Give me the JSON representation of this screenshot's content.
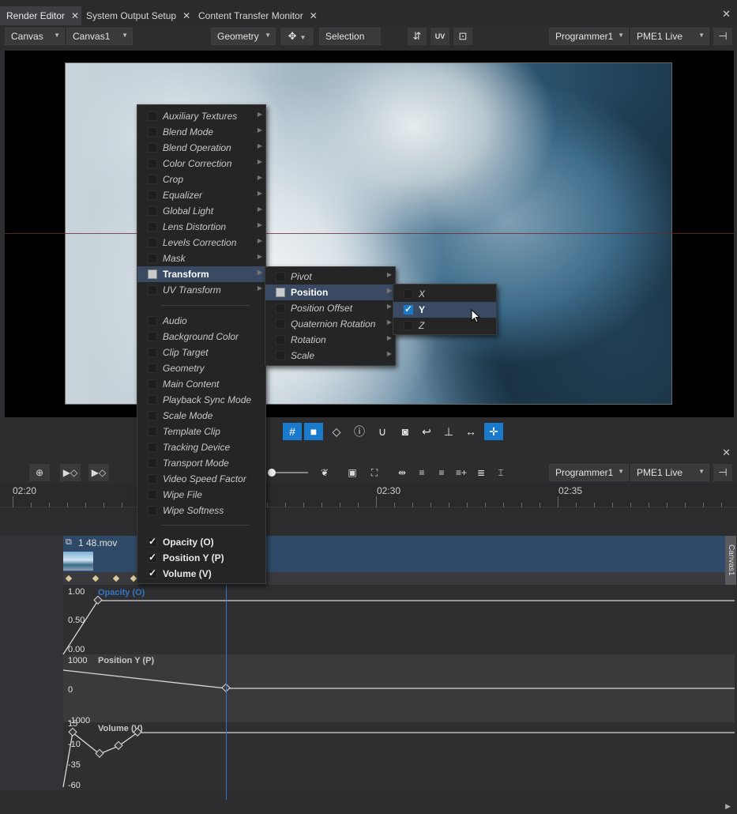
{
  "tabs": [
    {
      "label": "Render Editor",
      "active": true
    },
    {
      "label": "System Output Setup",
      "active": false
    },
    {
      "label": "Content Transfer Monitor",
      "active": false
    }
  ],
  "toolbar": {
    "canvas_type": "Canvas",
    "canvas_name": "Canvas1",
    "mode": "Geometry",
    "selection": "Selection",
    "programmer": "Programmer1",
    "live": "PME1 Live",
    "icons": [
      "move-icon",
      "flip-icon",
      "uv-icon",
      "frame-icon",
      "pin-icon"
    ]
  },
  "viewport_toolbar": {
    "icons": [
      "grid-icon",
      "camera-icon",
      "eraser-icon",
      "info-icon",
      "magnet-icon",
      "snapshot-icon",
      "undo-arrow-icon",
      "fit-height-icon",
      "fit-width-icon",
      "crosshair-icon"
    ],
    "active": [
      "grid-icon",
      "camera-icon",
      "crosshair-icon"
    ]
  },
  "timeline": {
    "programmer": "Programmer1",
    "live": "PME1 Live",
    "ruler": [
      "02:20",
      "02:30",
      "02:35"
    ],
    "clip": {
      "name": "1 48.mov",
      "canvas": "Canvas1"
    },
    "lanes": [
      {
        "name": "Opacity (O)",
        "values": [
          "1.00",
          "0.50",
          "0.00"
        ]
      },
      {
        "name": "Position Y (P)",
        "values": [
          "1000",
          "0",
          "-1000"
        ]
      },
      {
        "name": "Volume (V)",
        "values": [
          "15",
          "-10",
          "-35",
          "-60"
        ]
      }
    ]
  },
  "menu_main": {
    "group1": [
      {
        "label": "Auxiliary Textures",
        "submenu": true
      },
      {
        "label": "Blend Mode",
        "submenu": true
      },
      {
        "label": "Blend Operation",
        "submenu": true
      },
      {
        "label": "Color Correction",
        "submenu": true
      },
      {
        "label": "Crop",
        "submenu": true
      },
      {
        "label": "Equalizer",
        "submenu": true
      },
      {
        "label": "Global Light",
        "submenu": true
      },
      {
        "label": "Lens Distortion",
        "submenu": true
      },
      {
        "label": "Levels Correction",
        "submenu": true
      },
      {
        "label": "Mask",
        "submenu": true
      },
      {
        "label": "Transform",
        "submenu": true,
        "highlighted": true,
        "partial": true
      },
      {
        "label": "UV Transform",
        "submenu": true
      }
    ],
    "group2": [
      {
        "label": "Audio"
      },
      {
        "label": "Background Color"
      },
      {
        "label": "Clip Target"
      },
      {
        "label": "Geometry"
      },
      {
        "label": "Main Content"
      },
      {
        "label": "Playback Sync Mode"
      },
      {
        "label": "Scale Mode"
      },
      {
        "label": "Template Clip"
      },
      {
        "label": "Tracking Device"
      },
      {
        "label": "Transport Mode"
      },
      {
        "label": "Video Speed Factor"
      },
      {
        "label": "Wipe File"
      },
      {
        "label": "Wipe Softness"
      }
    ],
    "group3": [
      {
        "label": "Opacity (O)",
        "checked": true
      },
      {
        "label": "Position Y (P)",
        "checked": true
      },
      {
        "label": "Volume (V)",
        "checked": true
      }
    ]
  },
  "menu_transform": [
    {
      "label": "Pivot",
      "submenu": true
    },
    {
      "label": "Position",
      "submenu": true,
      "highlighted": true,
      "partial": true
    },
    {
      "label": "Position Offset",
      "submenu": true
    },
    {
      "label": "Quaternion Rotation",
      "submenu": true
    },
    {
      "label": "Rotation",
      "submenu": true
    },
    {
      "label": "Scale",
      "submenu": true
    }
  ],
  "menu_position": [
    {
      "label": "X",
      "checked": false
    },
    {
      "label": "Y",
      "checked": true,
      "highlighted": true
    },
    {
      "label": "Z",
      "checked": false
    }
  ],
  "colors": {
    "accent": "#1979ca",
    "menu_highlight": "#3a4a63",
    "clip": "#2f4a68",
    "playhead": "#2f78c8"
  }
}
